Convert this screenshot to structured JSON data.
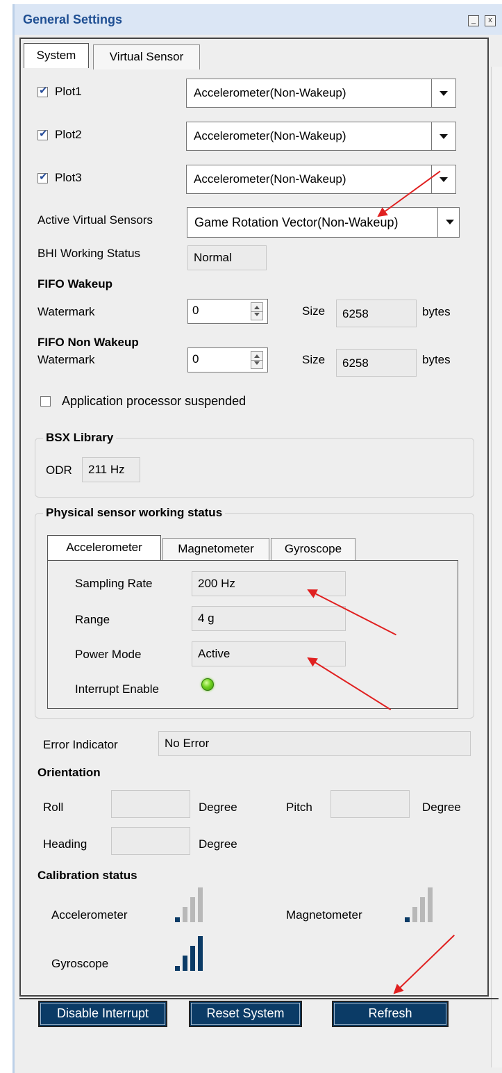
{
  "window": {
    "title": "General Settings",
    "minimize_glyph": "_",
    "close_glyph": "x"
  },
  "tabs": [
    {
      "label": "System",
      "active": true
    },
    {
      "label": "Virtual Sensor",
      "active": false
    }
  ],
  "plots": [
    {
      "label": "Plot1",
      "checked": true,
      "value": "Accelerometer(Non-Wakeup)"
    },
    {
      "label": "Plot2",
      "checked": true,
      "value": "Accelerometer(Non-Wakeup)"
    },
    {
      "label": "Plot3",
      "checked": true,
      "value": "Accelerometer(Non-Wakeup)"
    }
  ],
  "active_virtual_sensors": {
    "label": "Active Virtual Sensors",
    "value": "Game Rotation Vector(Non-Wakeup)"
  },
  "bhi_status": {
    "label": "BHI Working Status",
    "value": "Normal"
  },
  "fifo_wakeup": {
    "heading": "FIFO Wakeup",
    "watermark_label": "Watermark",
    "watermark_value": "0",
    "size_label": "Size",
    "size_value": "6258",
    "unit": "bytes"
  },
  "fifo_non_wakeup": {
    "heading": "FIFO Non Wakeup",
    "watermark_label": "Watermark",
    "watermark_value": "0",
    "size_label": "Size",
    "size_value": "6258",
    "unit": "bytes"
  },
  "ap_suspended": {
    "label": "Application processor suspended",
    "checked": false
  },
  "bsx": {
    "legend": "BSX Library",
    "odr_label": "ODR",
    "odr_value": "211 Hz"
  },
  "physical": {
    "legend": "Physical sensor working status",
    "tabs": [
      "Accelerometer",
      "Magnetometer",
      "Gyroscope"
    ],
    "sampling_rate_label": "Sampling Rate",
    "sampling_rate_value": "200 Hz",
    "range_label": "Range",
    "range_value": "4 g",
    "power_mode_label": "Power Mode",
    "power_mode_value": "Active",
    "interrupt_label": "Interrupt Enable",
    "interrupt_led_color": "#6fd01e"
  },
  "error": {
    "label": "Error Indicator",
    "value": "No Error"
  },
  "orientation": {
    "heading": "Orientation",
    "roll_label": "Roll",
    "pitch_label": "Pitch",
    "heading_label": "Heading",
    "roll_value": "",
    "pitch_value": "",
    "heading_value": "",
    "unit": "Degree"
  },
  "calibration": {
    "heading": "Calibration status",
    "items": [
      {
        "label": "Accelerometer",
        "level": 1,
        "max": 4
      },
      {
        "label": "Magnetometer",
        "level": 1,
        "max": 4
      },
      {
        "label": "Gyroscope",
        "level": 4,
        "max": 4
      }
    ]
  },
  "buttons": {
    "disable_interrupt": "Disable Interrupt",
    "reset_system": "Reset System",
    "refresh": "Refresh"
  },
  "colors": {
    "title_text": "#1f4f93",
    "title_bg": "#dbe6f5",
    "button_bg": "#0b3b66",
    "signal_on": "#0b3b66",
    "signal_off": "#b8b8b8",
    "annotation_arrow": "#e02020"
  }
}
